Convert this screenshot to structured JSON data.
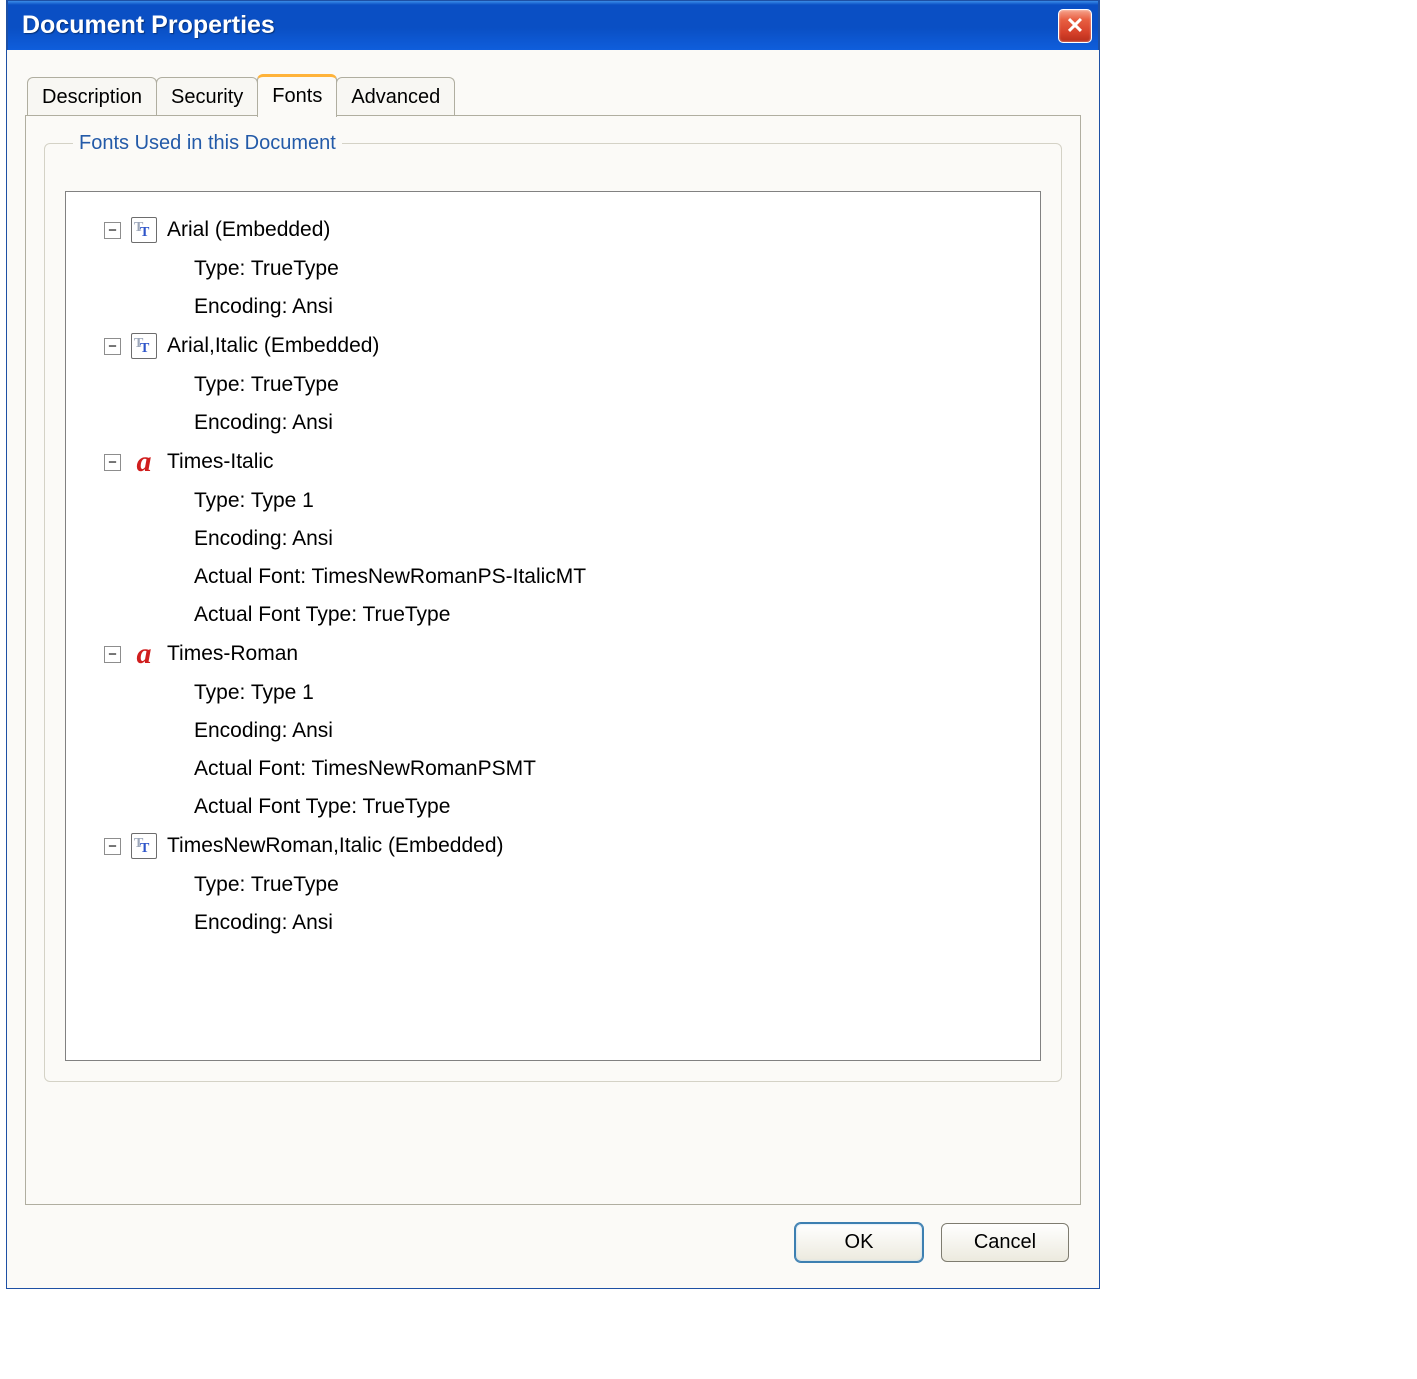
{
  "window": {
    "title": "Document Properties"
  },
  "tabs": [
    {
      "id": "description",
      "label": "Description",
      "active": false
    },
    {
      "id": "security",
      "label": "Security",
      "active": false
    },
    {
      "id": "fonts",
      "label": "Fonts",
      "active": true
    },
    {
      "id": "advanced",
      "label": "Advanced",
      "active": false
    }
  ],
  "group": {
    "legend": "Fonts Used in this Document"
  },
  "fonts": [
    {
      "name": "Arial (Embedded)",
      "iconType": "truetype",
      "details": [
        "Type: TrueType",
        "Encoding: Ansi"
      ]
    },
    {
      "name": "Arial,Italic (Embedded)",
      "iconType": "truetype",
      "details": [
        "Type: TrueType",
        "Encoding: Ansi"
      ]
    },
    {
      "name": "Times-Italic",
      "iconType": "type1",
      "details": [
        "Type: Type 1",
        "Encoding: Ansi",
        "Actual Font: TimesNewRomanPS-ItalicMT",
        "Actual Font Type: TrueType"
      ]
    },
    {
      "name": "Times-Roman",
      "iconType": "type1",
      "details": [
        "Type: Type 1",
        "Encoding: Ansi",
        "Actual Font: TimesNewRomanPSMT",
        "Actual Font Type: TrueType"
      ]
    },
    {
      "name": "TimesNewRoman,Italic (Embedded)",
      "iconType": "truetype",
      "details": [
        "Type: TrueType",
        "Encoding: Ansi"
      ]
    }
  ],
  "buttons": {
    "ok": "OK",
    "cancel": "Cancel"
  },
  "glyphs": {
    "minus": "−",
    "type1_glyph": "a"
  }
}
